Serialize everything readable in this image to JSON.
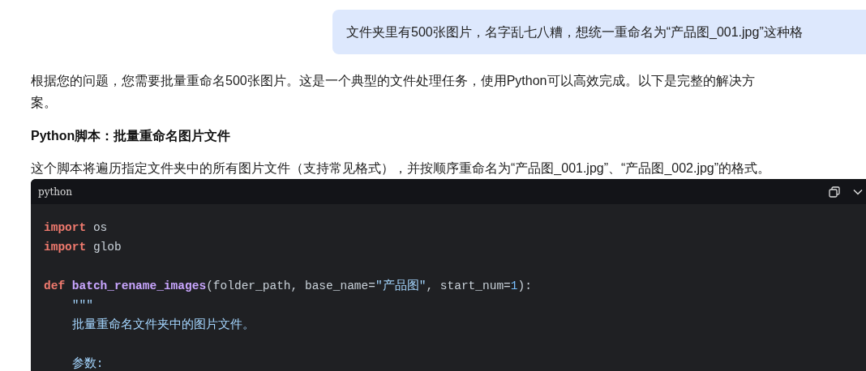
{
  "user_message": {
    "text": "文件夹里有500张图片，名字乱七八糟，想统一重命名为“产品图_001.jpg”这种格"
  },
  "answer": {
    "intro": "根据您的问题，您需要批量重命名500张图片。这是一个典型的文件处理任务，使用Python可以高效完成。以下是完整的解决方案。",
    "heading": "Python脚本：批量重命名图片文件",
    "description": "这个脚本将遍历指定文件夹中的所有图片文件（支持常见格式），并按顺序重命名为“产品图_001.jpg”、“产品图_002.jpg”的格式。",
    "code_block": {
      "language": "python",
      "lines": [
        {
          "kind": "code",
          "indented": false,
          "tokens": [
            {
              "kind": "keyword",
              "text": "import"
            },
            {
              "kind": "plain",
              "text": "os"
            }
          ]
        },
        {
          "kind": "code",
          "indented": false,
          "tokens": [
            {
              "kind": "keyword",
              "text": "import"
            },
            {
              "kind": "plain",
              "text": "glob"
            }
          ]
        },
        {
          "kind": "blank"
        },
        {
          "kind": "code",
          "indented": false,
          "tokens": [
            {
              "kind": "keyword",
              "text": "def"
            },
            {
              "kind": "function",
              "text": "batch_rename_images"
            },
            {
              "kind": "plain",
              "text": "(folder_path, base_name="
            },
            {
              "kind": "string",
              "text": "\"产品图\""
            },
            {
              "kind": "plain",
              "text": ", start_num="
            },
            {
              "kind": "number",
              "text": "1"
            },
            {
              "kind": "plain",
              "text": "):"
            }
          ]
        },
        {
          "kind": "code",
          "indented": true,
          "tokens": [
            {
              "kind": "docstring",
              "text": "\"\"\""
            }
          ]
        },
        {
          "kind": "code",
          "indented": true,
          "tokens": [
            {
              "kind": "docstring",
              "text": "批量重命名文件夹中的图片文件。"
            }
          ]
        },
        {
          "kind": "blank"
        },
        {
          "kind": "code",
          "indented": true,
          "tokens": [
            {
              "kind": "docstring",
              "text": "参数:"
            }
          ]
        }
      ]
    }
  }
}
